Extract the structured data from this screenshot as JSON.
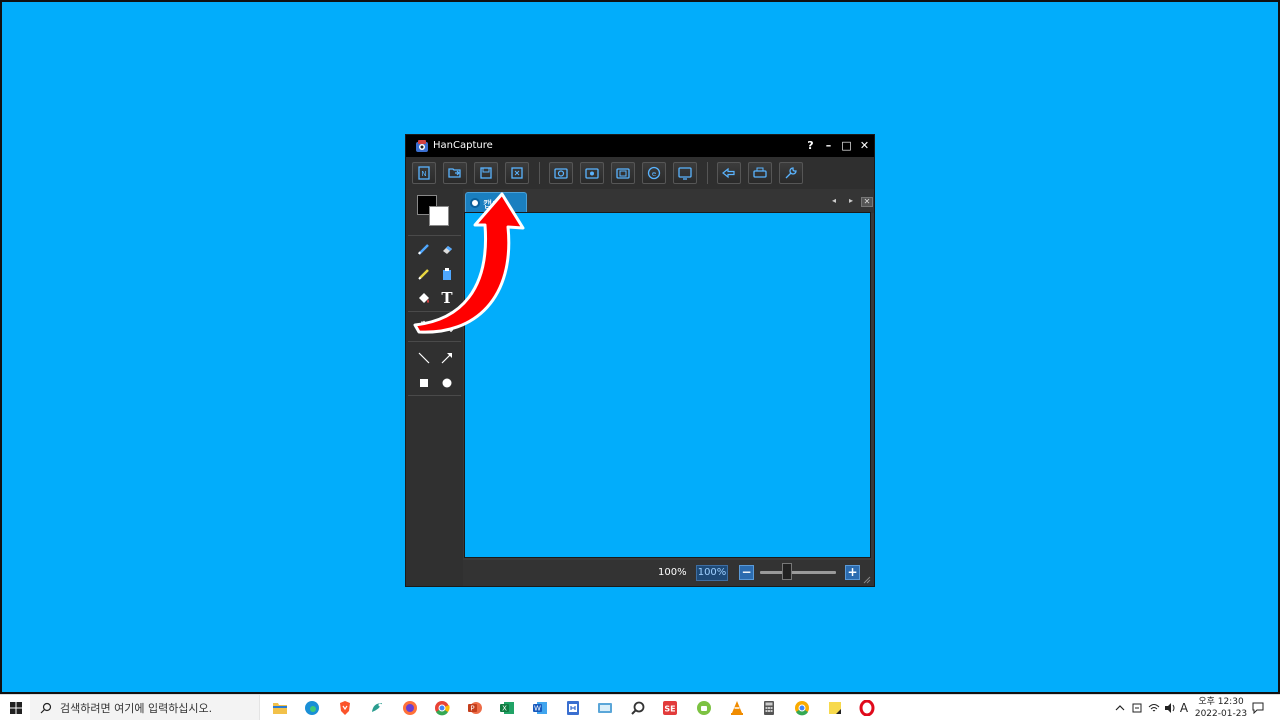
{
  "window": {
    "title": "HanCapture",
    "controls": [
      "?",
      "–",
      "□",
      "✕"
    ]
  },
  "toolbar": {
    "buttons": [
      "new-file-icon",
      "open-file-icon",
      "save-icon",
      "save-as-icon",
      "capture-area-icon",
      "capture-window-icon",
      "capture-scroll-icon",
      "capture-web-icon",
      "capture-screen-icon",
      "undo-icon",
      "print-icon",
      "settings-wrench-icon"
    ]
  },
  "tools": [
    "pen-icon",
    "eraser-icon",
    "highlighter-icon",
    "clipboard-icon",
    "fill-bucket-icon",
    "text-icon",
    "hand-pan-icon",
    "crop-icon",
    "line-icon",
    "arrow-icon",
    "rectangle-icon",
    "ellipse-icon"
  ],
  "tools_text": {
    "text": "T"
  },
  "colors": {
    "foreground": "#000000",
    "background": "#ffffff",
    "accent": "#1a7fc0",
    "canvas": "#02adfb",
    "annotation_arrow": "#ff0000"
  },
  "tab": {
    "label": "캡처",
    "nav_prev": "◂",
    "nav_next": "▸",
    "close": "✕"
  },
  "status": {
    "zoom_label": "100%",
    "zoom_value": "100%",
    "zoom_minus": "−",
    "zoom_plus": "+"
  },
  "taskbar": {
    "search_placeholder": "검색하려면 여기에 입력하십시오.",
    "apps": [
      "file-explorer-icon",
      "edge-icon",
      "brave-icon",
      "app-icon",
      "firefox-icon",
      "chrome-icon",
      "powerpoint-icon",
      "excel-icon",
      "word-icon",
      "hancom-icon",
      "remote-icon",
      "search-app-icon",
      "se-app-icon",
      "android-icon",
      "vlc-icon",
      "calculator-icon",
      "chrome-canary-icon",
      "sticky-notes-icon",
      "opera-icon"
    ],
    "tray_ime": "A",
    "clock_line1": "오후 12:30",
    "clock_line2": "2022-01-23"
  }
}
